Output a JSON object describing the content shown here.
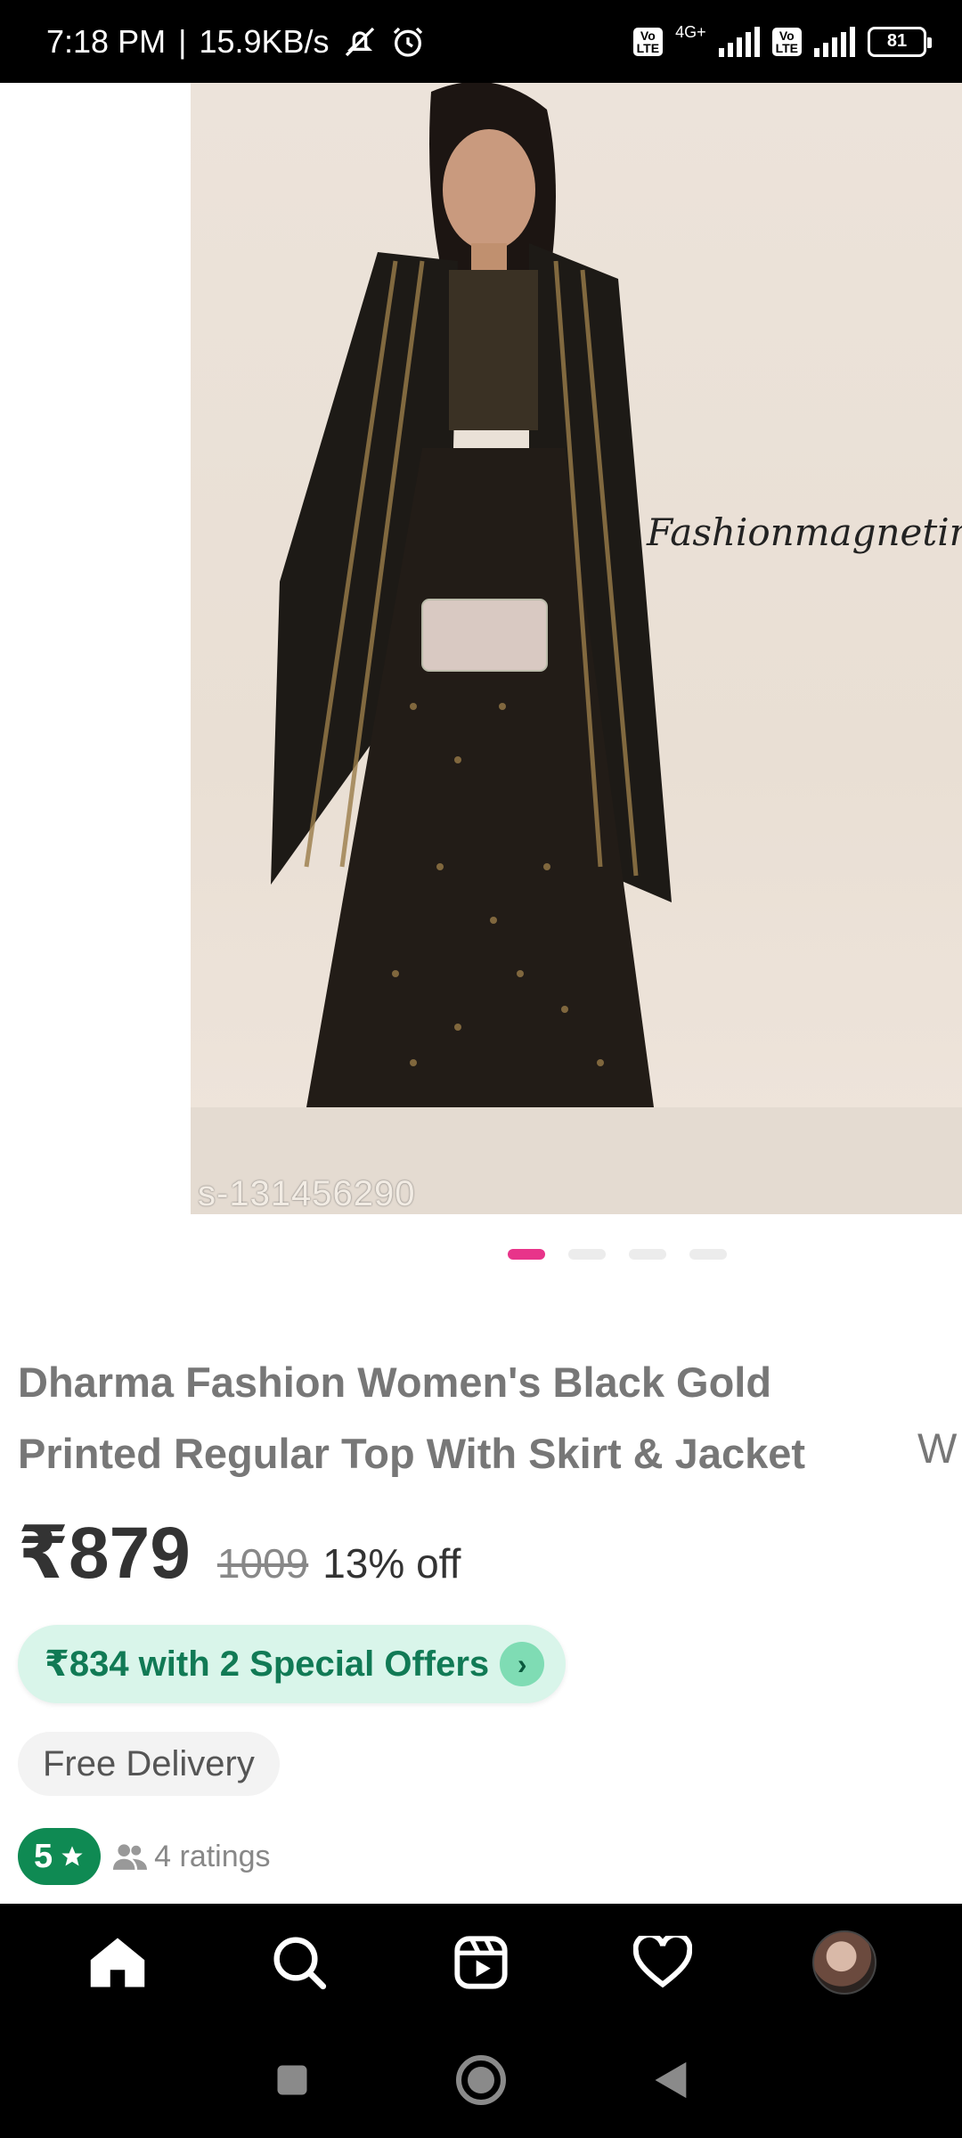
{
  "status_bar": {
    "time": "7:18 PM",
    "speed": "15.9KB/s",
    "network_label": "4G+",
    "lte_badge": "Vo LTE",
    "battery": "81"
  },
  "product": {
    "image_watermark_brand": "Fashionmagnetindi",
    "image_code": "s-131456290",
    "carousel_count": 4,
    "carousel_active_index": 0,
    "title": "Dharma Fashion Women's Black Gold Printed Regular Top With Skirt & Jacket",
    "next_card_peek": "W",
    "price": "₹879",
    "mrp": "1009",
    "discount": "13% off",
    "offer": "₹834 with 2 Special Offers",
    "delivery": "Free Delivery",
    "rating": "5",
    "ratings_count": "4 ratings"
  },
  "bottom_nav": {
    "items": [
      "home-icon",
      "search-icon",
      "reels-icon",
      "heart-icon",
      "profile-avatar"
    ]
  },
  "colors": {
    "accent_pink": "#e8348a",
    "rating_green": "#0f8a53",
    "offer_bg": "#d9f5ea"
  }
}
